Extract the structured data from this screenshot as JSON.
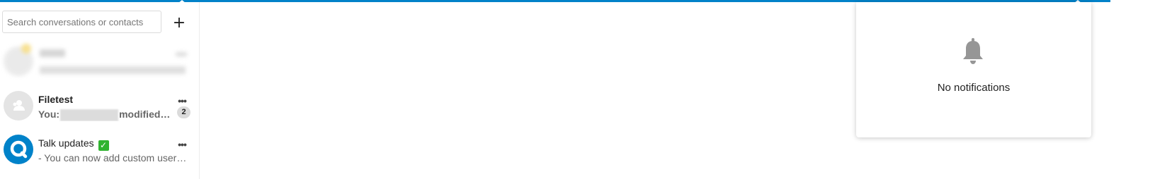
{
  "colors": {
    "accent": "#0082c9",
    "avatar_grey": "#e4e4e4",
    "badge_bg": "#dbdbdb",
    "check_green": "#30b330"
  },
  "search": {
    "placeholder": "Search conversations or contacts"
  },
  "sidebar": {
    "add_button_label": "+",
    "conversations": [
      {
        "name": "",
        "message": "",
        "icon": "blurred-conversation"
      },
      {
        "name": "Filetest",
        "message_prefix": "You:",
        "message_suffix": "modified…",
        "more_label": "•••",
        "unread_count": "2",
        "icon": "group-icon"
      },
      {
        "name": "Talk updates",
        "name_suffix_icon": "check-mark-icon",
        "name_suffix": "✓",
        "message": "- You can now add custom user g…",
        "more_label": "•••",
        "icon": "talk-logo-icon"
      }
    ]
  },
  "notifications": {
    "empty_text": "No notifications",
    "icon": "bell-icon"
  }
}
